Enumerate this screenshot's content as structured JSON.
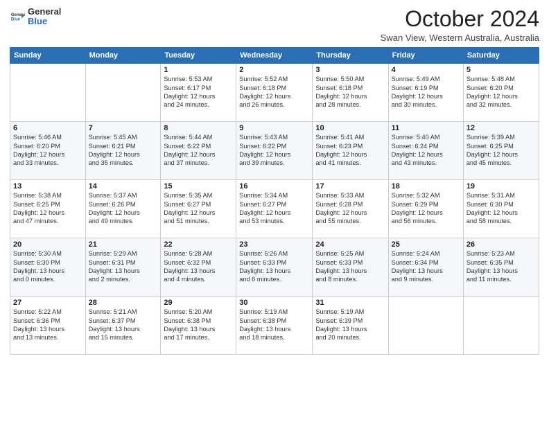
{
  "logo": {
    "general": "General",
    "blue": "Blue"
  },
  "header": {
    "month": "October 2024",
    "subtitle": "Swan View, Western Australia, Australia"
  },
  "days_of_week": [
    "Sunday",
    "Monday",
    "Tuesday",
    "Wednesday",
    "Thursday",
    "Friday",
    "Saturday"
  ],
  "weeks": [
    [
      {
        "day": "",
        "info": ""
      },
      {
        "day": "",
        "info": ""
      },
      {
        "day": "1",
        "info": "Sunrise: 5:53 AM\nSunset: 6:17 PM\nDaylight: 12 hours\nand 24 minutes."
      },
      {
        "day": "2",
        "info": "Sunrise: 5:52 AM\nSunset: 6:18 PM\nDaylight: 12 hours\nand 26 minutes."
      },
      {
        "day": "3",
        "info": "Sunrise: 5:50 AM\nSunset: 6:18 PM\nDaylight: 12 hours\nand 28 minutes."
      },
      {
        "day": "4",
        "info": "Sunrise: 5:49 AM\nSunset: 6:19 PM\nDaylight: 12 hours\nand 30 minutes."
      },
      {
        "day": "5",
        "info": "Sunrise: 5:48 AM\nSunset: 6:20 PM\nDaylight: 12 hours\nand 32 minutes."
      }
    ],
    [
      {
        "day": "6",
        "info": "Sunrise: 5:46 AM\nSunset: 6:20 PM\nDaylight: 12 hours\nand 33 minutes."
      },
      {
        "day": "7",
        "info": "Sunrise: 5:45 AM\nSunset: 6:21 PM\nDaylight: 12 hours\nand 35 minutes."
      },
      {
        "day": "8",
        "info": "Sunrise: 5:44 AM\nSunset: 6:22 PM\nDaylight: 12 hours\nand 37 minutes."
      },
      {
        "day": "9",
        "info": "Sunrise: 5:43 AM\nSunset: 6:22 PM\nDaylight: 12 hours\nand 39 minutes."
      },
      {
        "day": "10",
        "info": "Sunrise: 5:41 AM\nSunset: 6:23 PM\nDaylight: 12 hours\nand 41 minutes."
      },
      {
        "day": "11",
        "info": "Sunrise: 5:40 AM\nSunset: 6:24 PM\nDaylight: 12 hours\nand 43 minutes."
      },
      {
        "day": "12",
        "info": "Sunrise: 5:39 AM\nSunset: 6:25 PM\nDaylight: 12 hours\nand 45 minutes."
      }
    ],
    [
      {
        "day": "13",
        "info": "Sunrise: 5:38 AM\nSunset: 6:25 PM\nDaylight: 12 hours\nand 47 minutes."
      },
      {
        "day": "14",
        "info": "Sunrise: 5:37 AM\nSunset: 6:26 PM\nDaylight: 12 hours\nand 49 minutes."
      },
      {
        "day": "15",
        "info": "Sunrise: 5:35 AM\nSunset: 6:27 PM\nDaylight: 12 hours\nand 51 minutes."
      },
      {
        "day": "16",
        "info": "Sunrise: 5:34 AM\nSunset: 6:27 PM\nDaylight: 12 hours\nand 53 minutes."
      },
      {
        "day": "17",
        "info": "Sunrise: 5:33 AM\nSunset: 6:28 PM\nDaylight: 12 hours\nand 55 minutes."
      },
      {
        "day": "18",
        "info": "Sunrise: 5:32 AM\nSunset: 6:29 PM\nDaylight: 12 hours\nand 56 minutes."
      },
      {
        "day": "19",
        "info": "Sunrise: 5:31 AM\nSunset: 6:30 PM\nDaylight: 12 hours\nand 58 minutes."
      }
    ],
    [
      {
        "day": "20",
        "info": "Sunrise: 5:30 AM\nSunset: 6:30 PM\nDaylight: 13 hours\nand 0 minutes."
      },
      {
        "day": "21",
        "info": "Sunrise: 5:29 AM\nSunset: 6:31 PM\nDaylight: 13 hours\nand 2 minutes."
      },
      {
        "day": "22",
        "info": "Sunrise: 5:28 AM\nSunset: 6:32 PM\nDaylight: 13 hours\nand 4 minutes."
      },
      {
        "day": "23",
        "info": "Sunrise: 5:26 AM\nSunset: 6:33 PM\nDaylight: 13 hours\nand 6 minutes."
      },
      {
        "day": "24",
        "info": "Sunrise: 5:25 AM\nSunset: 6:33 PM\nDaylight: 13 hours\nand 8 minutes."
      },
      {
        "day": "25",
        "info": "Sunrise: 5:24 AM\nSunset: 6:34 PM\nDaylight: 13 hours\nand 9 minutes."
      },
      {
        "day": "26",
        "info": "Sunrise: 5:23 AM\nSunset: 6:35 PM\nDaylight: 13 hours\nand 11 minutes."
      }
    ],
    [
      {
        "day": "27",
        "info": "Sunrise: 5:22 AM\nSunset: 6:36 PM\nDaylight: 13 hours\nand 13 minutes."
      },
      {
        "day": "28",
        "info": "Sunrise: 5:21 AM\nSunset: 6:37 PM\nDaylight: 13 hours\nand 15 minutes."
      },
      {
        "day": "29",
        "info": "Sunrise: 5:20 AM\nSunset: 6:38 PM\nDaylight: 13 hours\nand 17 minutes."
      },
      {
        "day": "30",
        "info": "Sunrise: 5:19 AM\nSunset: 6:38 PM\nDaylight: 13 hours\nand 18 minutes."
      },
      {
        "day": "31",
        "info": "Sunrise: 5:19 AM\nSunset: 6:39 PM\nDaylight: 13 hours\nand 20 minutes."
      },
      {
        "day": "",
        "info": ""
      },
      {
        "day": "",
        "info": ""
      }
    ]
  ]
}
